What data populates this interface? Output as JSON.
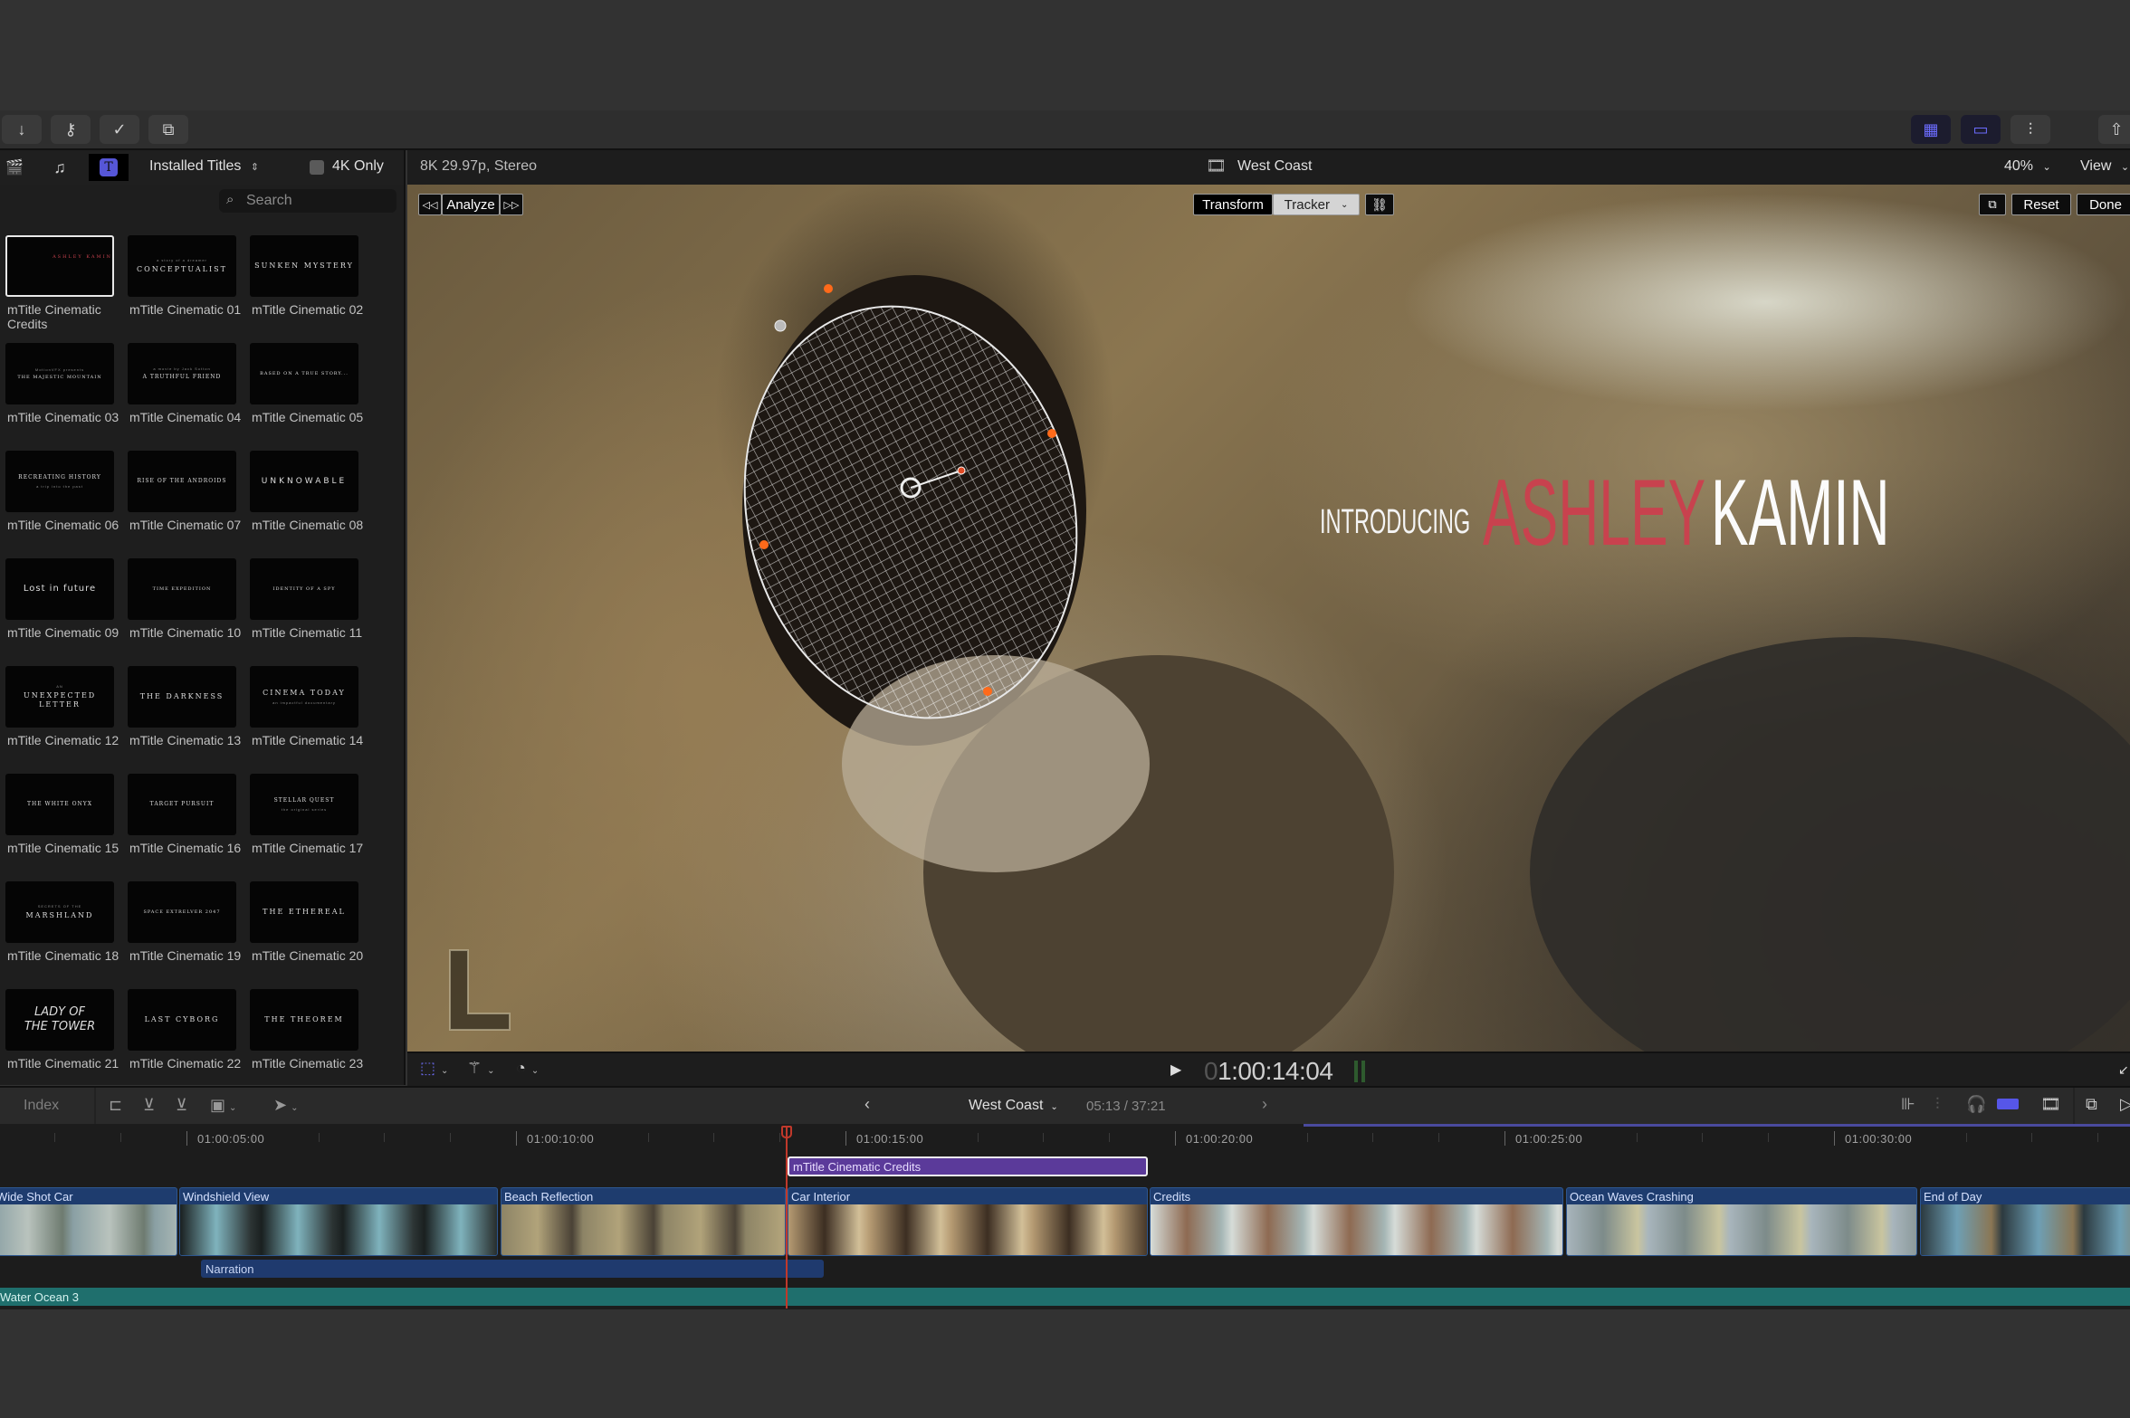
{
  "toolbar": {
    "left_buttons": [
      {
        "name": "import-button",
        "icon": "download-arrow-icon",
        "glyph": "↓"
      },
      {
        "name": "keywords-button",
        "icon": "key-icon",
        "glyph": "⚷"
      },
      {
        "name": "background-tasks-button",
        "icon": "checkmark-circle-icon",
        "glyph": "✓"
      },
      {
        "name": "extensions-button",
        "icon": "puzzle-icon",
        "glyph": "⧉"
      }
    ],
    "right_buttons": [
      {
        "name": "browser-toggle-button",
        "icon": "grid-icon",
        "glyph": "▦",
        "active": true
      },
      {
        "name": "timeline-toggle-button",
        "icon": "filmstrip-icon",
        "glyph": "▭",
        "active": true
      },
      {
        "name": "inspector-toggle-button",
        "icon": "sliders-icon",
        "glyph": "⫶",
        "active": false
      },
      {
        "name": "share-button",
        "icon": "share-icon",
        "glyph": "⇧",
        "active": false
      }
    ]
  },
  "browser": {
    "tabs": [
      {
        "name": "libraries-tab",
        "icon": "clapper-star-icon",
        "glyph": "🎬"
      },
      {
        "name": "photos-audio-tab",
        "icon": "photos-music-icon",
        "glyph": "♫"
      },
      {
        "name": "titles-generators-tab",
        "icon": "titles-icon",
        "glyph": "T",
        "active": true
      }
    ],
    "category": "Installed Titles",
    "category_chevron": "⌃⌄",
    "filter_4k_label": "4K Only",
    "filter_4k_checked": false,
    "search_placeholder": "Search",
    "titles": [
      {
        "label": "mTitle Cinematic Credits",
        "preview": "ASHLEY KAMIN",
        "sub": "",
        "selected": true
      },
      {
        "label": "mTitle Cinematic 01",
        "preview": "CONCEPTUALIST",
        "sub": "a story of a dreamer"
      },
      {
        "label": "mTitle Cinematic 02",
        "preview": "SUNKEN MYSTERY",
        "sub": ""
      },
      {
        "label": "mTitle Cinematic 03",
        "preview": "THE MAJESTIC MOUNTAIN",
        "sub": "MotionVFX presents"
      },
      {
        "label": "mTitle Cinematic 04",
        "preview": "A TRUTHFUL FRIEND",
        "sub": "a movie by Jack Sutton"
      },
      {
        "label": "mTitle Cinematic 05",
        "preview": "BASED ON A TRUE STORY...",
        "sub": ""
      },
      {
        "label": "mTitle Cinematic 06",
        "preview": "RECREATING HISTORY",
        "sub": "a trip into the past"
      },
      {
        "label": "mTitle Cinematic 07",
        "preview": "RISE OF THE ANDROIDS",
        "sub": ""
      },
      {
        "label": "mTitle Cinematic 08",
        "preview": "UNKNOWABLE",
        "sub": ""
      },
      {
        "label": "mTitle Cinematic 09",
        "preview": "Lost in future",
        "sub": ""
      },
      {
        "label": "mTitle Cinematic 10",
        "preview": "TIME EXPEDITION",
        "sub": ""
      },
      {
        "label": "mTitle Cinematic 11",
        "preview": "IDENTITY OF A SPY",
        "sub": ""
      },
      {
        "label": "mTitle Cinematic 12",
        "preview": "UNEXPECTED LETTER",
        "sub": "AN"
      },
      {
        "label": "mTitle Cinematic 13",
        "preview": "THE DARKNESS",
        "sub": ""
      },
      {
        "label": "mTitle Cinematic 14",
        "preview": "CINEMA TODAY",
        "sub": "an impactful documentary"
      },
      {
        "label": "mTitle Cinematic 15",
        "preview": "THE WHITE ONYX",
        "sub": ""
      },
      {
        "label": "mTitle Cinematic 16",
        "preview": "TARGET PURSUIT",
        "sub": ""
      },
      {
        "label": "mTitle Cinematic 17",
        "preview": "STELLAR QUEST",
        "sub": "the original series"
      },
      {
        "label": "mTitle Cinematic 18",
        "preview": "MARSHLAND",
        "sub": "SECRETS OF THE"
      },
      {
        "label": "mTitle Cinematic 19",
        "preview": "SPACE EXTRELVER 2047",
        "sub": ""
      },
      {
        "label": "mTitle Cinematic 20",
        "preview": "THE ETHEREAL",
        "sub": ""
      },
      {
        "label": "mTitle Cinematic 21",
        "preview": "LADY OF THE TOWER",
        "sub": ""
      },
      {
        "label": "mTitle Cinematic 22",
        "preview": "LAST CYBORG",
        "sub": ""
      },
      {
        "label": "mTitle Cinematic 23",
        "preview": "THE THEOREM",
        "sub": ""
      }
    ]
  },
  "viewer": {
    "format": "8K 29.97p, Stereo",
    "project_name": "West Coast",
    "zoom": "40%",
    "view_menu": "View",
    "analyze_label": "Analyze",
    "prev_frame_glyph": "⏪",
    "next_frame_glyph": "⏩",
    "mode_tabs": [
      {
        "label": "Transform",
        "active": true
      },
      {
        "label": "Tracker",
        "active": false
      }
    ],
    "link_glyph": "🔗",
    "reset_label": "Reset",
    "done_label": "Done",
    "overlay_title": {
      "intro": "INTRODUCING",
      "first_name": "ASHLEY",
      "last_name": "KAMIN"
    },
    "timecode_dim": "0",
    "timecode": "1:00:14:04",
    "play_glyph": "▶",
    "accent_color": "#6b6bf0",
    "title_red": "#c8424e"
  },
  "timeline": {
    "index_label": "Index",
    "project_name": "West Coast",
    "duration": "05:13 / 37:21",
    "ruler": [
      "01:00:05:00",
      "01:00:10:00",
      "01:00:15:00",
      "01:00:20:00",
      "01:00:25:00",
      "01:00:30:00"
    ],
    "title_clip": "mTitle Cinematic Credits",
    "clips": [
      {
        "label": "Wide Shot Car"
      },
      {
        "label": "Windshield View"
      },
      {
        "label": "Beach Reflection"
      },
      {
        "label": "Car Interior"
      },
      {
        "label": "Credits"
      },
      {
        "label": "Ocean Waves Crashing"
      },
      {
        "label": "End of Day"
      }
    ],
    "narration": "Narration",
    "music": "Water Ocean 3",
    "colors": {
      "primary_clip": "#1e3c6e",
      "title_clip": "#5b3a9a",
      "music_clip": "#1f6f6d",
      "playhead": "#c0392b"
    }
  }
}
